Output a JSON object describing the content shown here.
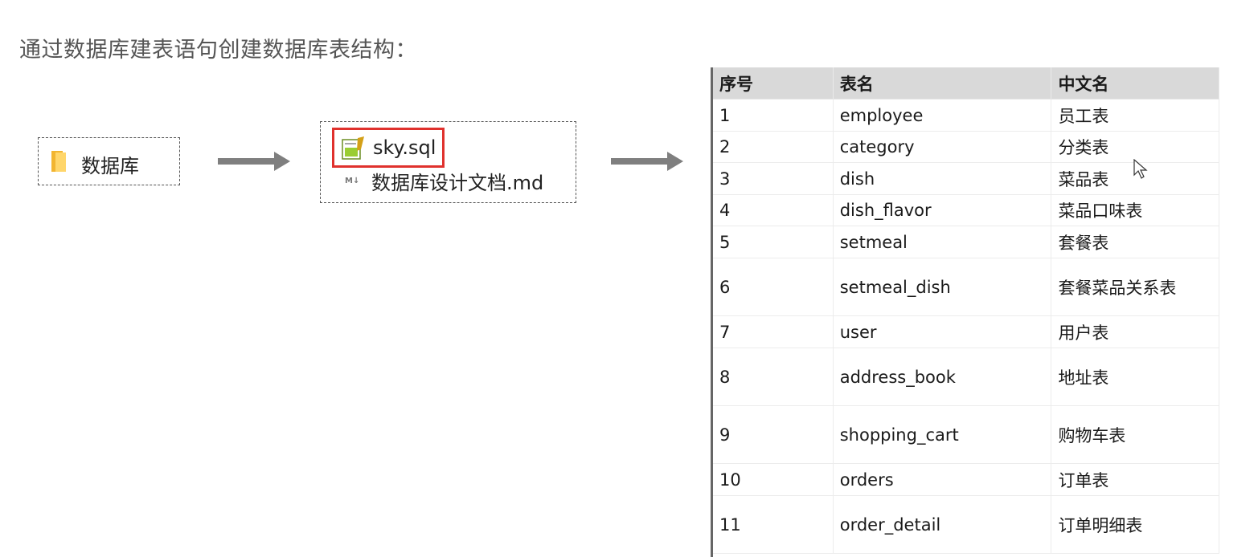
{
  "heading": "通过数据库建表语句创建数据库表结构：",
  "db_folder": {
    "label": "数据库",
    "icon": "folder-icon"
  },
  "files": [
    {
      "name": "sky.sql",
      "icon": "sql-file-icon",
      "highlight": "#e0312d"
    },
    {
      "name": "数据库设计文档.md",
      "icon": "markdown-file-icon"
    }
  ],
  "table": {
    "headers": [
      "序号",
      "表名",
      "中文名"
    ],
    "rows": [
      [
        "1",
        "employee",
        "员工表"
      ],
      [
        "2",
        "category",
        "分类表"
      ],
      [
        "3",
        "dish",
        "菜品表"
      ],
      [
        "4",
        "dish_flavor",
        "菜品口味表"
      ],
      [
        "5",
        "setmeal",
        "套餐表"
      ],
      [
        "6",
        "setmeal_dish",
        "套餐菜品关系表"
      ],
      [
        "7",
        "user",
        "用户表"
      ],
      [
        "8",
        "address_book",
        "地址表"
      ],
      [
        "9",
        "shopping_cart",
        "购物车表"
      ],
      [
        "10",
        "orders",
        "订单表"
      ],
      [
        "11",
        "order_detail",
        "订单明细表"
      ]
    ]
  },
  "colors": {
    "header_bg": "#d9d9d9",
    "arrow": "#7f7f7f",
    "accent": "#e0312d"
  }
}
